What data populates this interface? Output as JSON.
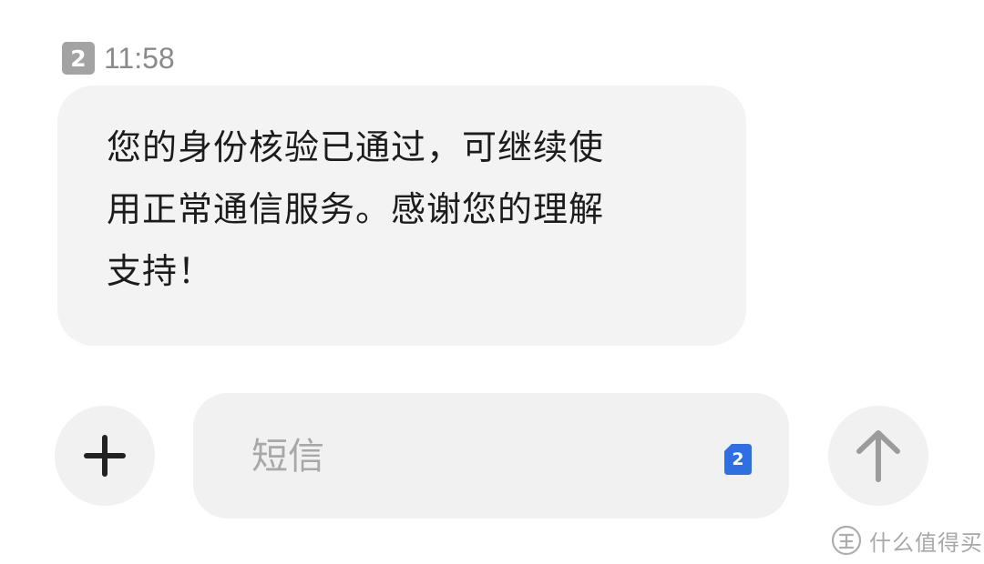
{
  "message": {
    "sim_number": "2",
    "time": "11:58",
    "body": "您的身份核验已通过，可继续使\n用正常通信服务。感谢您的理解\n支持！"
  },
  "composer": {
    "placeholder": "短信",
    "sim_indicator": "2",
    "add_icon": "plus-icon",
    "send_icon": "arrow-up-icon",
    "accent": "#2f6fe4"
  },
  "watermark": {
    "text": "什么值得买",
    "logo": "zhi-logo-icon"
  }
}
